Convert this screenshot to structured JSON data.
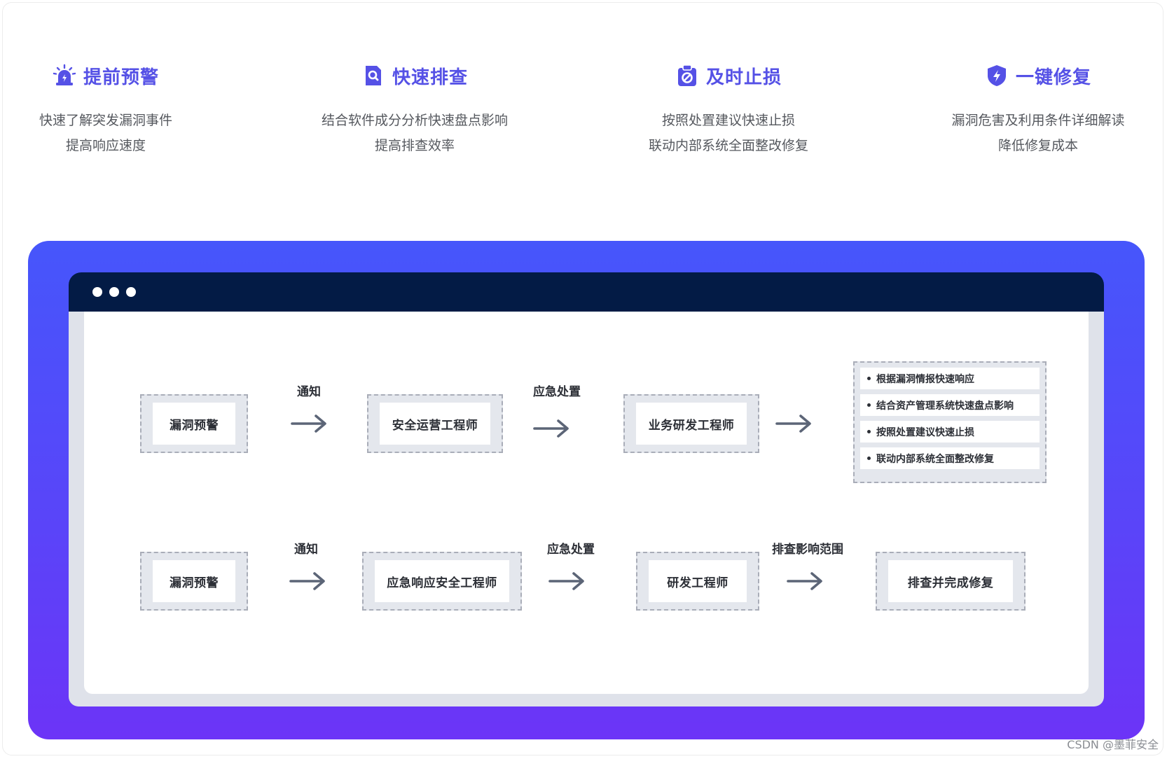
{
  "features": [
    {
      "icon": "alarm-icon",
      "title": "提前预警",
      "desc": [
        "快速了解突发漏洞事件",
        "提高响应速度"
      ]
    },
    {
      "icon": "search-doc-icon",
      "title": "快速排查",
      "desc": [
        "结合软件成分分析快速盘点影响",
        "提高排查效率"
      ]
    },
    {
      "icon": "stop-clipboard-icon",
      "title": "及时止损",
      "desc": [
        "按照处置建议快速止损",
        "联动内部系统全面整改修复"
      ]
    },
    {
      "icon": "shield-bolt-icon",
      "title": "一键修复",
      "desc": [
        "漏洞危害及利用条件详细解读",
        "降低修复成本"
      ]
    }
  ],
  "colors": {
    "accent": "#5551e6",
    "panel_top": "#4656fb",
    "panel_bottom": "#6c34f7",
    "titlebar": "#031b45"
  },
  "flow1": {
    "node1": "漏洞预警",
    "label1": "通知",
    "node2": "安全运营工程师",
    "label2": "应急处置",
    "node3": "业务研发工程师",
    "actions": [
      "根据漏洞情报快速响应",
      "结合资产管理系统快速盘点影响",
      "按照处置建议快速止损",
      "联动内部系统全面整改修复"
    ]
  },
  "flow2": {
    "node1": "漏洞预警",
    "label1": "通知",
    "node2": "应急响应安全工程师",
    "label2": "应急处置",
    "node3": "研发工程师",
    "label3": "排查影响范围",
    "node4": "排查并完成修复"
  },
  "watermark": "CSDN @墨菲安全"
}
